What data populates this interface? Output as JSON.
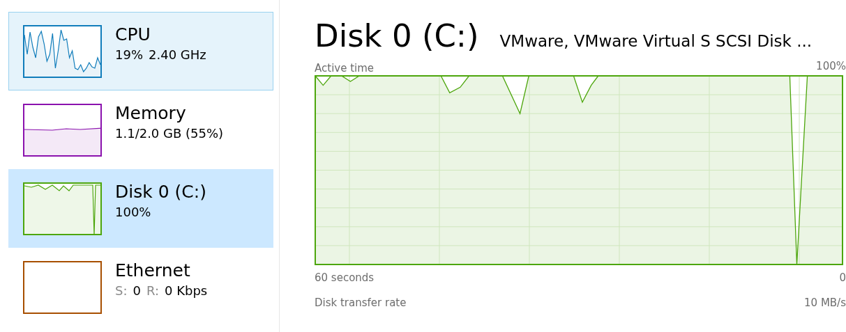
{
  "sidebar": {
    "items": [
      {
        "name": "CPU",
        "detail": [
          {
            "text": "19%",
            "muted": false
          },
          {
            "text": "2.40 GHz",
            "muted": false
          }
        ],
        "color": "#117dbb",
        "selected": false,
        "hovered": true
      },
      {
        "name": "Memory",
        "detail": [
          {
            "text": "1.1/2.0 GB (55%)",
            "muted": false
          }
        ],
        "color": "#8b12ae",
        "selected": false,
        "hovered": false
      },
      {
        "name": "Disk 0 (C:)",
        "detail": [
          {
            "text": "100%",
            "muted": false
          }
        ],
        "color": "#4da60c",
        "selected": true,
        "hovered": false
      },
      {
        "name": "Ethernet",
        "detail": [
          {
            "text": "S:",
            "muted": true
          },
          {
            "text": "0",
            "muted": false
          },
          {
            "text": "R:",
            "muted": true
          },
          {
            "text": "0 Kbps",
            "muted": false
          }
        ],
        "color": "#a74f01",
        "selected": false,
        "hovered": false
      }
    ]
  },
  "main": {
    "title": "Disk 0 (C:)",
    "model": "VMware, VMware Virtual S SCSI Disk ...",
    "graph": {
      "title": "Active time",
      "top_label": "100%",
      "bottom_label": "0",
      "span_label": "60 seconds",
      "color": "#4da60c"
    },
    "next_chart": {
      "title": "Disk transfer rate",
      "max": "10 MB/s"
    }
  }
}
